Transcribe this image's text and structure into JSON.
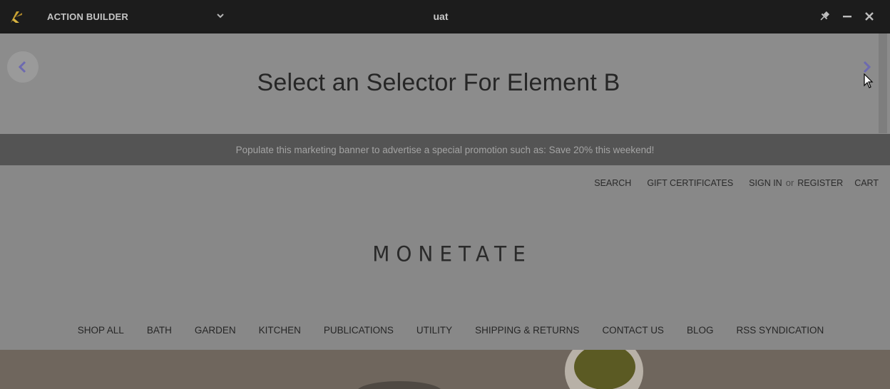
{
  "titlebar": {
    "app_name": "ACTION BUILDER",
    "environment": "uat",
    "logo_icon": "monetate-k-logo-icon",
    "dropdown_icon": "chevron-down-icon",
    "pin_icon": "pin-icon",
    "minimize_icon": "minimize-icon",
    "close_icon": "close-icon"
  },
  "panel": {
    "title": "Select an Selector For Element B",
    "prev_icon": "chevron-left-icon",
    "next_icon": "chevron-right-icon"
  },
  "promo": {
    "text": "Populate this marketing banner to advertise a special promotion such as: Save 20% this weekend!"
  },
  "site": {
    "utility": {
      "search": "SEARCH",
      "gift": "GIFT CERTIFICATES",
      "sign_in": "SIGN IN",
      "or": "or",
      "register": "REGISTER",
      "cart": "CART"
    },
    "logo": "MONETATE",
    "nav": [
      "SHOP ALL",
      "BATH",
      "GARDEN",
      "KITCHEN",
      "PUBLICATIONS",
      "UTILITY",
      "SHIPPING & RETURNS",
      "CONTACT US",
      "BLOG",
      "RSS SYNDICATION"
    ]
  },
  "colors": {
    "titlebar_bg": "#1c1c1c",
    "overlay_bg": "#888888",
    "promo_bg": "#545454",
    "accent": "#6d6ab0"
  }
}
